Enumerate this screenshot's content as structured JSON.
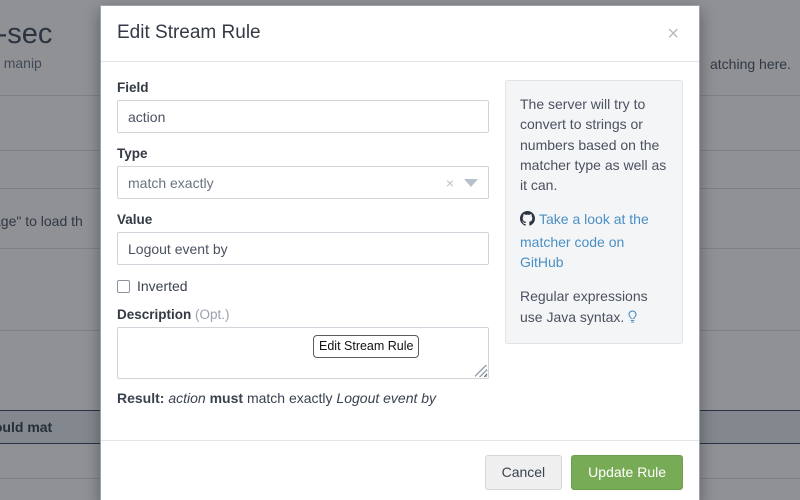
{
  "background": {
    "title": "local-sec",
    "subtitle": "tion and manip",
    "right_text": "atching here.",
    "mid_text": "sage\" to load th",
    "highlight_text": "f it would mat"
  },
  "modal": {
    "title": "Edit Stream Rule",
    "close_icon": "close-icon",
    "form": {
      "field": {
        "label": "Field",
        "value": "action",
        "placeholder": "Field"
      },
      "type": {
        "label": "Type",
        "value": "match exactly",
        "clear_icon": "×",
        "arrow_icon": "chevron-down-icon"
      },
      "value": {
        "label": "Value",
        "value": "Logout event by",
        "placeholder": "Value"
      },
      "inverted": {
        "label": "Inverted",
        "checked": false
      },
      "description": {
        "label": "Description",
        "optional_suffix": "(Opt.)",
        "value": "",
        "placeholder": ""
      },
      "floating_tip": "Edit Stream Rule"
    },
    "result": {
      "label": "Result:",
      "field": "action",
      "must": "must",
      "matcher": "match exactly",
      "value": "Logout event by"
    },
    "help": {
      "paragraph": "The server will try to convert to strings or numbers based on the matcher type as well as it can.",
      "link_text": "Take a look at the matcher code on GitHub",
      "github_icon": "github-icon",
      "regex_text": "Regular expressions use Java syntax.",
      "bulb_icon": "lightbulb-icon"
    },
    "footer": {
      "cancel_label": "Cancel",
      "submit_label": "Update Rule"
    }
  },
  "colors": {
    "primary": "#78ab56",
    "link": "#4a90c4",
    "text": "#3a4250",
    "muted": "#9aa2ad",
    "panel_bg": "#f4f5f7"
  }
}
